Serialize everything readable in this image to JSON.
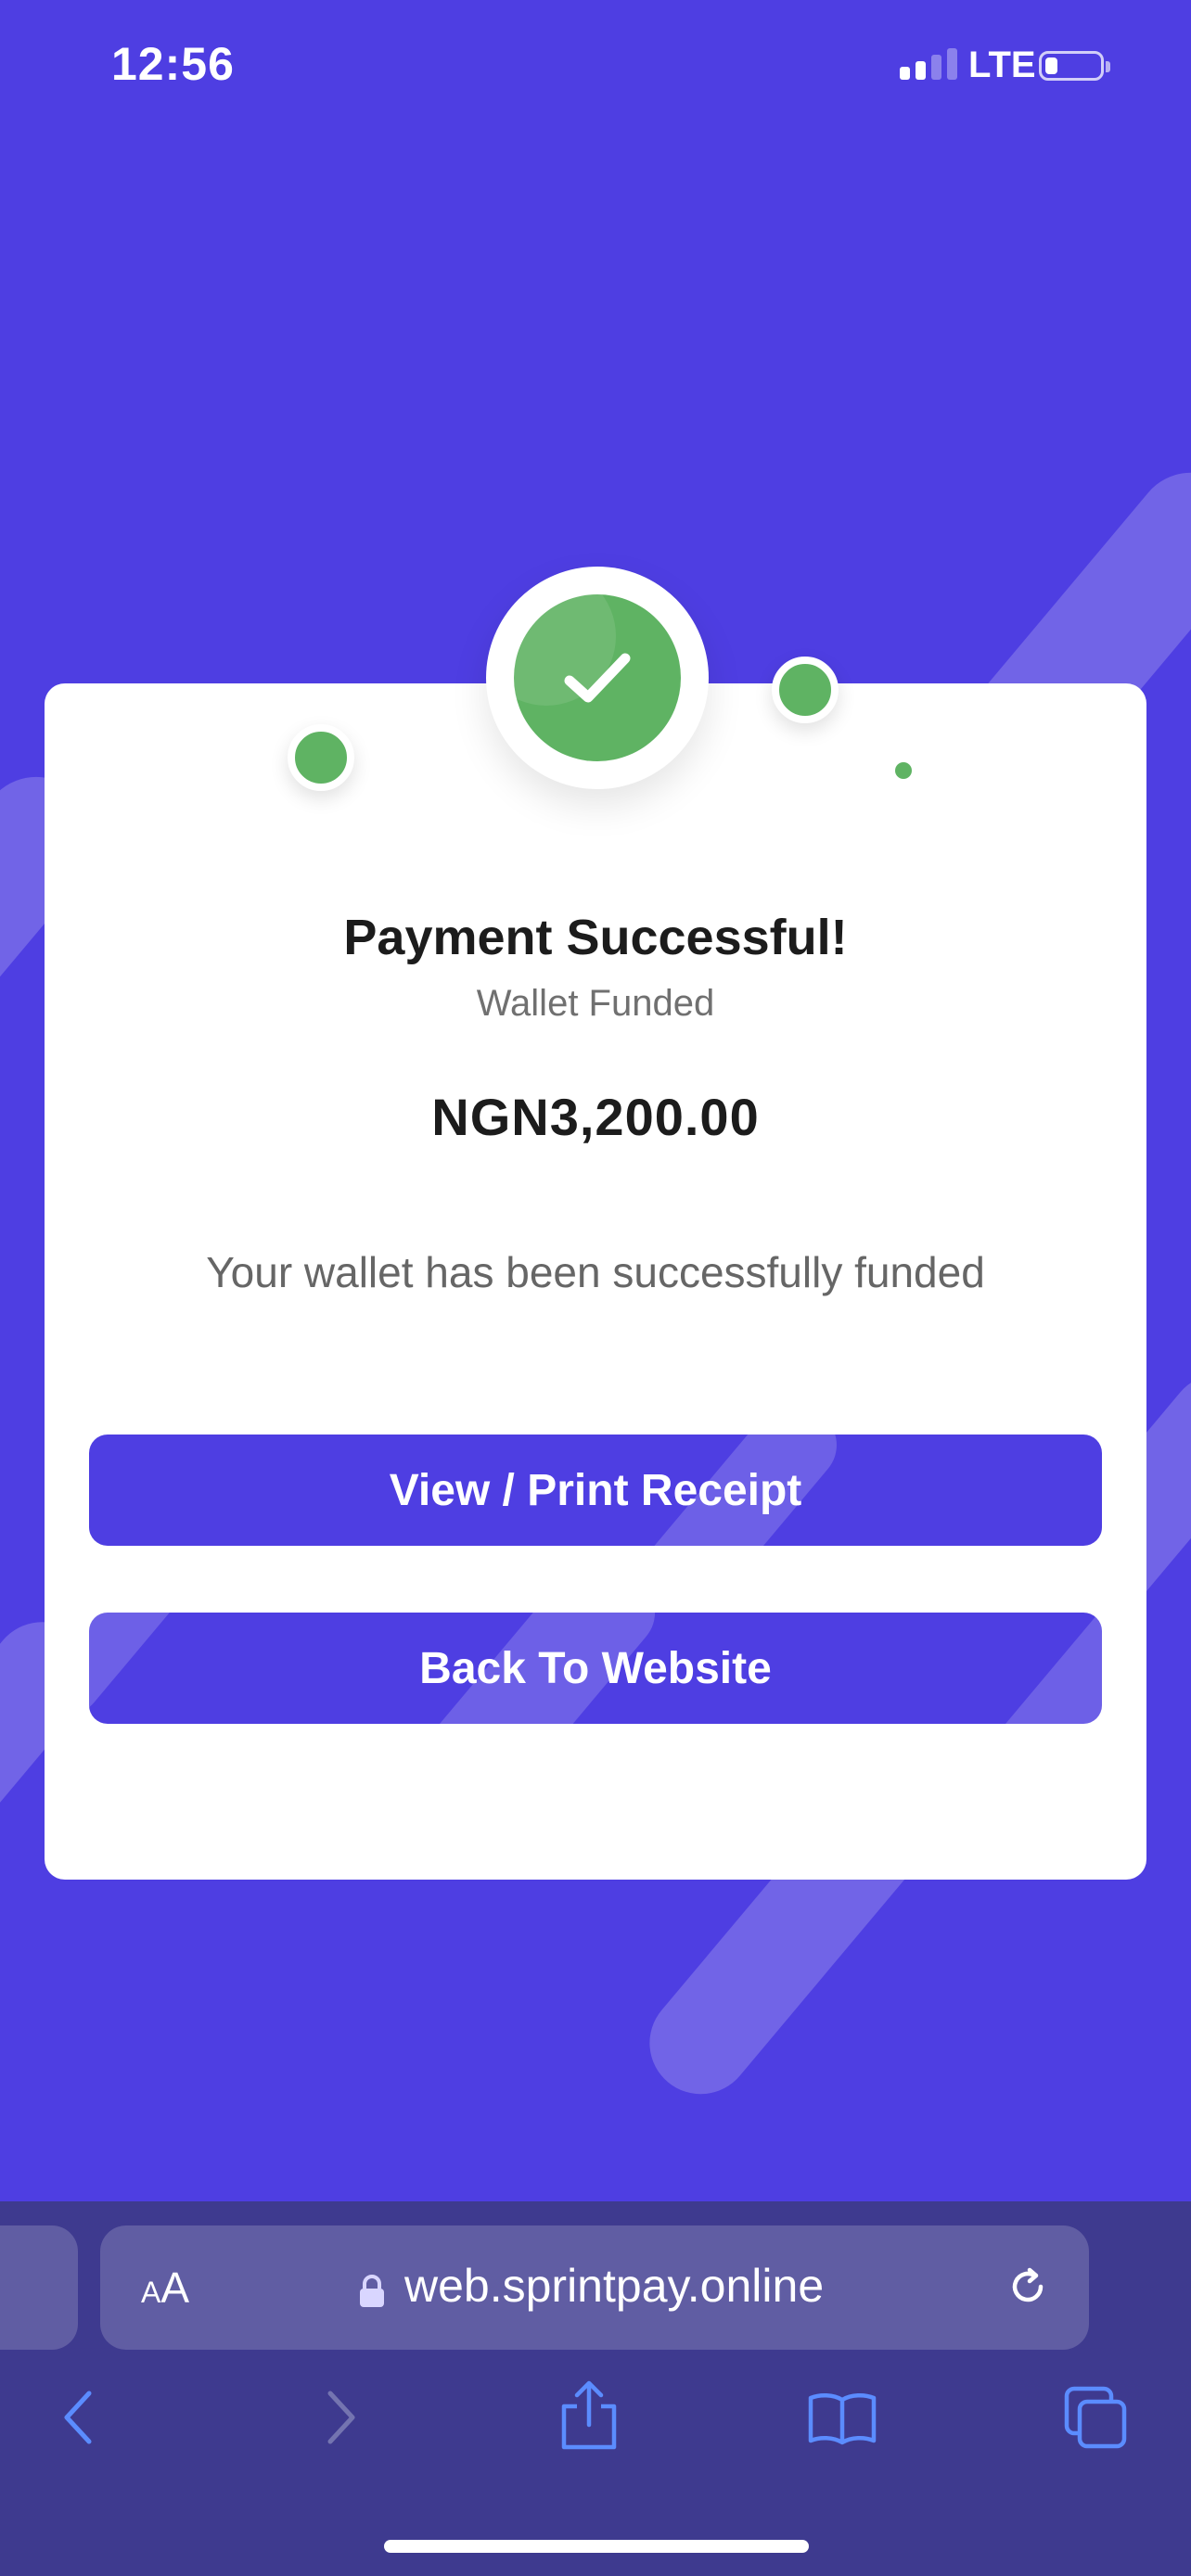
{
  "status_bar": {
    "time": "12:56",
    "network": "LTE"
  },
  "colors": {
    "background": "#4e3ee2",
    "success_green": "#5fb363",
    "button": "#4e3ee2",
    "browser_bar": "#3e3a8f"
  },
  "receipt": {
    "title": "Payment Successful!",
    "subtitle": "Wallet Funded",
    "amount": "NGN3,200.00",
    "message": "Your wallet has been successfully funded",
    "status_icon": "check-icon"
  },
  "actions": {
    "view_receipt_label": "View / Print Receipt",
    "back_label": "Back To Website"
  },
  "browser": {
    "text_size_label_small": "A",
    "text_size_label_large": "A",
    "url": "web.sprintpay.online",
    "icons": [
      "back-icon",
      "forward-icon",
      "share-icon",
      "bookmarks-icon",
      "tabs-icon",
      "lock-icon",
      "reload-icon"
    ]
  }
}
